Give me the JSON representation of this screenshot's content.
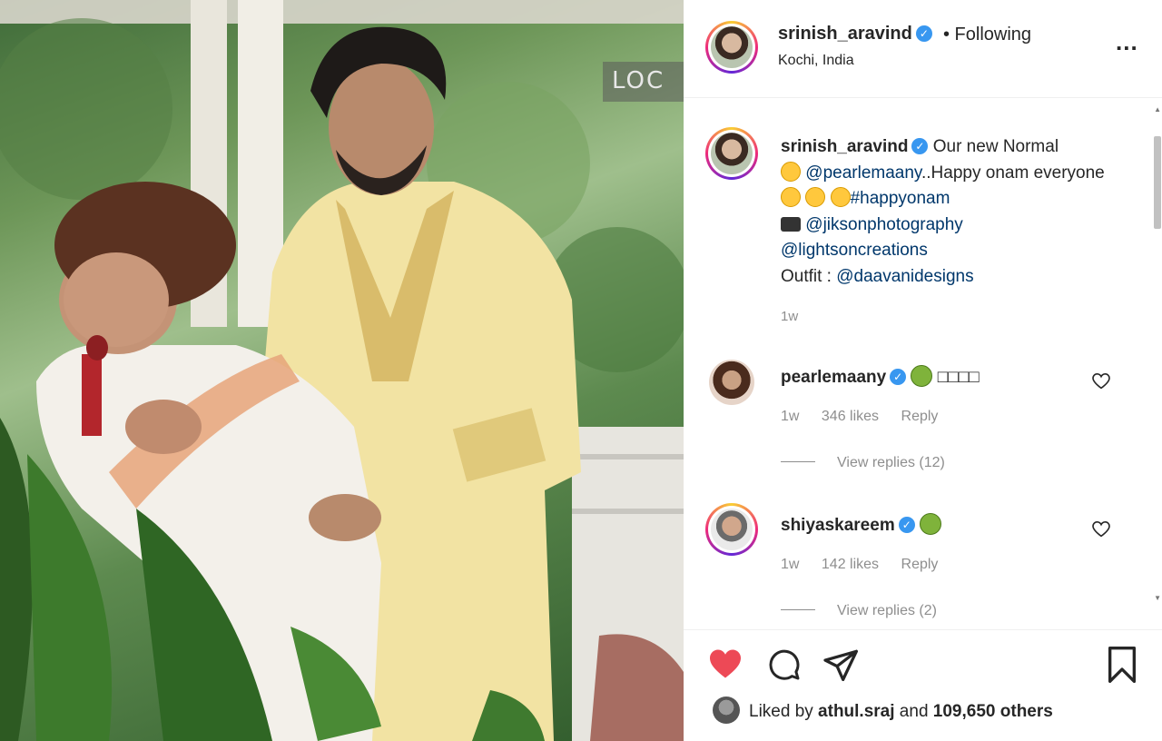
{
  "photo": {
    "tag": "LOC"
  },
  "header": {
    "username": "srinish_aravind",
    "verified": "✓",
    "follow_status": "• Following",
    "location": "Kochi, India",
    "more": "..."
  },
  "caption": {
    "username": "srinish_aravind",
    "line1": " Our new Normal",
    "mention1": " @pearlemaany",
    "line2": "..Happy onam everyone ",
    "hashtag": "#happyonam",
    "mention2": " @jiksonphotography",
    "mention3": "@lightsoncreations",
    "outfit_label": "Outfit : ",
    "mention4": "@daavanidesigns",
    "time": "1w"
  },
  "comments": [
    {
      "username": "pearlemaany",
      "text": "□□□□",
      "time": "1w",
      "likes": "346 likes",
      "reply": "Reply",
      "view_replies": "View replies (12)"
    },
    {
      "username": "shiyaskareem",
      "text": "",
      "time": "1w",
      "likes": "142 likes",
      "reply": "Reply",
      "view_replies": "View replies (2)"
    }
  ],
  "likes": {
    "prefix": "Liked by ",
    "user": "athul.sraj",
    "middle": " and ",
    "others": "109,650 others"
  },
  "colors": {
    "like_red": "#ed4956",
    "link_blue": "#00376b",
    "verified_blue": "#3897f0"
  },
  "icons": [
    "heart-icon",
    "comment-icon",
    "share-icon",
    "bookmark-icon",
    "more-icon",
    "verified-icon"
  ]
}
